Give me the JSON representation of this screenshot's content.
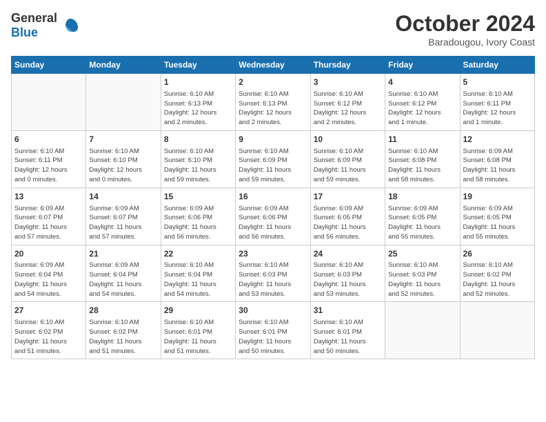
{
  "header": {
    "logo_general": "General",
    "logo_blue": "Blue",
    "month_year": "October 2024",
    "location": "Baradougou, Ivory Coast"
  },
  "days_of_week": [
    "Sunday",
    "Monday",
    "Tuesday",
    "Wednesday",
    "Thursday",
    "Friday",
    "Saturday"
  ],
  "weeks": [
    [
      {
        "day": "",
        "info": ""
      },
      {
        "day": "",
        "info": ""
      },
      {
        "day": "1",
        "info": "Sunrise: 6:10 AM\nSunset: 6:13 PM\nDaylight: 12 hours\nand 2 minutes."
      },
      {
        "day": "2",
        "info": "Sunrise: 6:10 AM\nSunset: 6:13 PM\nDaylight: 12 hours\nand 2 minutes."
      },
      {
        "day": "3",
        "info": "Sunrise: 6:10 AM\nSunset: 6:12 PM\nDaylight: 12 hours\nand 2 minutes."
      },
      {
        "day": "4",
        "info": "Sunrise: 6:10 AM\nSunset: 6:12 PM\nDaylight: 12 hours\nand 1 minute."
      },
      {
        "day": "5",
        "info": "Sunrise: 6:10 AM\nSunset: 6:11 PM\nDaylight: 12 hours\nand 1 minute."
      }
    ],
    [
      {
        "day": "6",
        "info": "Sunrise: 6:10 AM\nSunset: 6:11 PM\nDaylight: 12 hours\nand 0 minutes."
      },
      {
        "day": "7",
        "info": "Sunrise: 6:10 AM\nSunset: 6:10 PM\nDaylight: 12 hours\nand 0 minutes."
      },
      {
        "day": "8",
        "info": "Sunrise: 6:10 AM\nSunset: 6:10 PM\nDaylight: 11 hours\nand 59 minutes."
      },
      {
        "day": "9",
        "info": "Sunrise: 6:10 AM\nSunset: 6:09 PM\nDaylight: 11 hours\nand 59 minutes."
      },
      {
        "day": "10",
        "info": "Sunrise: 6:10 AM\nSunset: 6:09 PM\nDaylight: 11 hours\nand 59 minutes."
      },
      {
        "day": "11",
        "info": "Sunrise: 6:10 AM\nSunset: 6:08 PM\nDaylight: 11 hours\nand 58 minutes."
      },
      {
        "day": "12",
        "info": "Sunrise: 6:09 AM\nSunset: 6:08 PM\nDaylight: 11 hours\nand 58 minutes."
      }
    ],
    [
      {
        "day": "13",
        "info": "Sunrise: 6:09 AM\nSunset: 6:07 PM\nDaylight: 11 hours\nand 57 minutes."
      },
      {
        "day": "14",
        "info": "Sunrise: 6:09 AM\nSunset: 6:07 PM\nDaylight: 11 hours\nand 57 minutes."
      },
      {
        "day": "15",
        "info": "Sunrise: 6:09 AM\nSunset: 6:06 PM\nDaylight: 11 hours\nand 56 minutes."
      },
      {
        "day": "16",
        "info": "Sunrise: 6:09 AM\nSunset: 6:06 PM\nDaylight: 11 hours\nand 56 minutes."
      },
      {
        "day": "17",
        "info": "Sunrise: 6:09 AM\nSunset: 6:05 PM\nDaylight: 11 hours\nand 56 minutes."
      },
      {
        "day": "18",
        "info": "Sunrise: 6:09 AM\nSunset: 6:05 PM\nDaylight: 11 hours\nand 55 minutes."
      },
      {
        "day": "19",
        "info": "Sunrise: 6:09 AM\nSunset: 6:05 PM\nDaylight: 11 hours\nand 55 minutes."
      }
    ],
    [
      {
        "day": "20",
        "info": "Sunrise: 6:09 AM\nSunset: 6:04 PM\nDaylight: 11 hours\nand 54 minutes."
      },
      {
        "day": "21",
        "info": "Sunrise: 6:09 AM\nSunset: 6:04 PM\nDaylight: 11 hours\nand 54 minutes."
      },
      {
        "day": "22",
        "info": "Sunrise: 6:10 AM\nSunset: 6:04 PM\nDaylight: 11 hours\nand 54 minutes."
      },
      {
        "day": "23",
        "info": "Sunrise: 6:10 AM\nSunset: 6:03 PM\nDaylight: 11 hours\nand 53 minutes."
      },
      {
        "day": "24",
        "info": "Sunrise: 6:10 AM\nSunset: 6:03 PM\nDaylight: 11 hours\nand 53 minutes."
      },
      {
        "day": "25",
        "info": "Sunrise: 6:10 AM\nSunset: 6:03 PM\nDaylight: 11 hours\nand 52 minutes."
      },
      {
        "day": "26",
        "info": "Sunrise: 6:10 AM\nSunset: 6:02 PM\nDaylight: 11 hours\nand 52 minutes."
      }
    ],
    [
      {
        "day": "27",
        "info": "Sunrise: 6:10 AM\nSunset: 6:02 PM\nDaylight: 11 hours\nand 51 minutes."
      },
      {
        "day": "28",
        "info": "Sunrise: 6:10 AM\nSunset: 6:02 PM\nDaylight: 11 hours\nand 51 minutes."
      },
      {
        "day": "29",
        "info": "Sunrise: 6:10 AM\nSunset: 6:01 PM\nDaylight: 11 hours\nand 51 minutes."
      },
      {
        "day": "30",
        "info": "Sunrise: 6:10 AM\nSunset: 6:01 PM\nDaylight: 11 hours\nand 50 minutes."
      },
      {
        "day": "31",
        "info": "Sunrise: 6:10 AM\nSunset: 6:01 PM\nDaylight: 11 hours\nand 50 minutes."
      },
      {
        "day": "",
        "info": ""
      },
      {
        "day": "",
        "info": ""
      }
    ]
  ]
}
